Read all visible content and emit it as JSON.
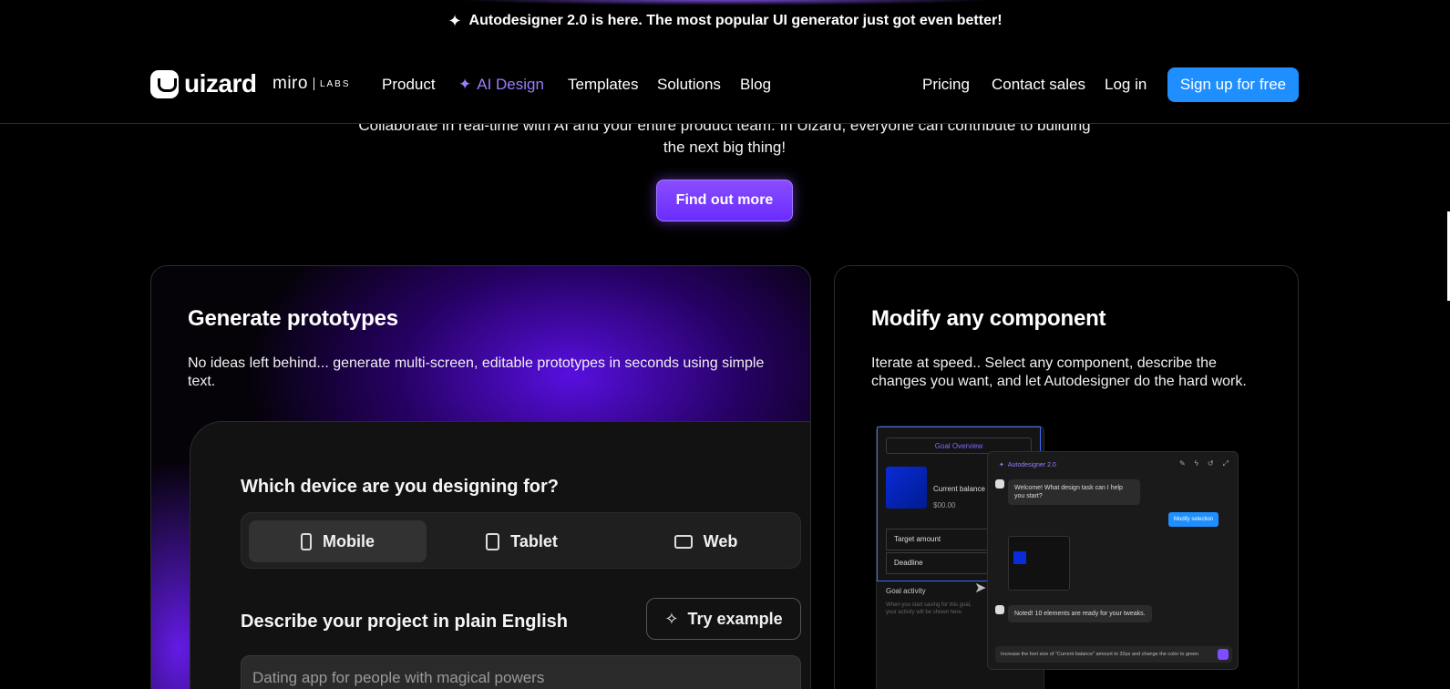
{
  "announcement": {
    "icon": "sparkle-icon",
    "text": "Autodesigner 2.0 is here. The most popular UI generator just got even better!"
  },
  "header": {
    "logo_text": "uizard",
    "partner_text": "miro",
    "partner_suffix": "LABS",
    "nav_left": [
      "Product",
      "AI Design",
      "Templates",
      "Solutions",
      "Blog"
    ],
    "nav_right": [
      "Pricing",
      "Contact sales",
      "Log in"
    ],
    "signup_label": "Sign up for free",
    "accent_color": "#1f8fff",
    "ai_color": "#9c7cff"
  },
  "hero": {
    "text": "Collaborate in real-time with AI and your entire product team. In Uizard, everyone can contribute to building the next big thing!",
    "cta_label": "Find out more"
  },
  "cards": {
    "left": {
      "title": "Generate prototypes",
      "description": "No ideas left behind... generate multi-screen, editable prototypes in seconds using simple text.",
      "mockup": {
        "question": "Which device are you designing for?",
        "devices": [
          "Mobile",
          "Tablet",
          "Web"
        ],
        "selected_device": "Mobile",
        "describe_label": "Describe your project in plain English",
        "try_example_label": "Try example",
        "prompt_placeholder": "Dating app for people with magical powers"
      }
    },
    "right": {
      "title": "Modify any component",
      "description_line1": "Iterate at speed.. Select any component, describe the",
      "description_line2": "changes you want, and let Autodesigner do the hard work.",
      "mockup": {
        "screen_title": "Goal Overview",
        "balance_label": "Current balance",
        "balance_value": "$00.00",
        "target_label": "Target amount",
        "deadline_label": "Deadline",
        "activity_label": "Goal activity",
        "activity_note": "When you start saving for this goal, your activity will be shown here.",
        "chat_title": "Autodesigner 2.0",
        "welcome_msg": "Welcome! What design task can I help you start?",
        "modify_label": "Modify selection",
        "result_msg": "Noted! 10 elements are ready for your tweaks.",
        "input_text": "Increase the font size of \"Current balance\" amount to 32px and change the color to green"
      }
    }
  }
}
